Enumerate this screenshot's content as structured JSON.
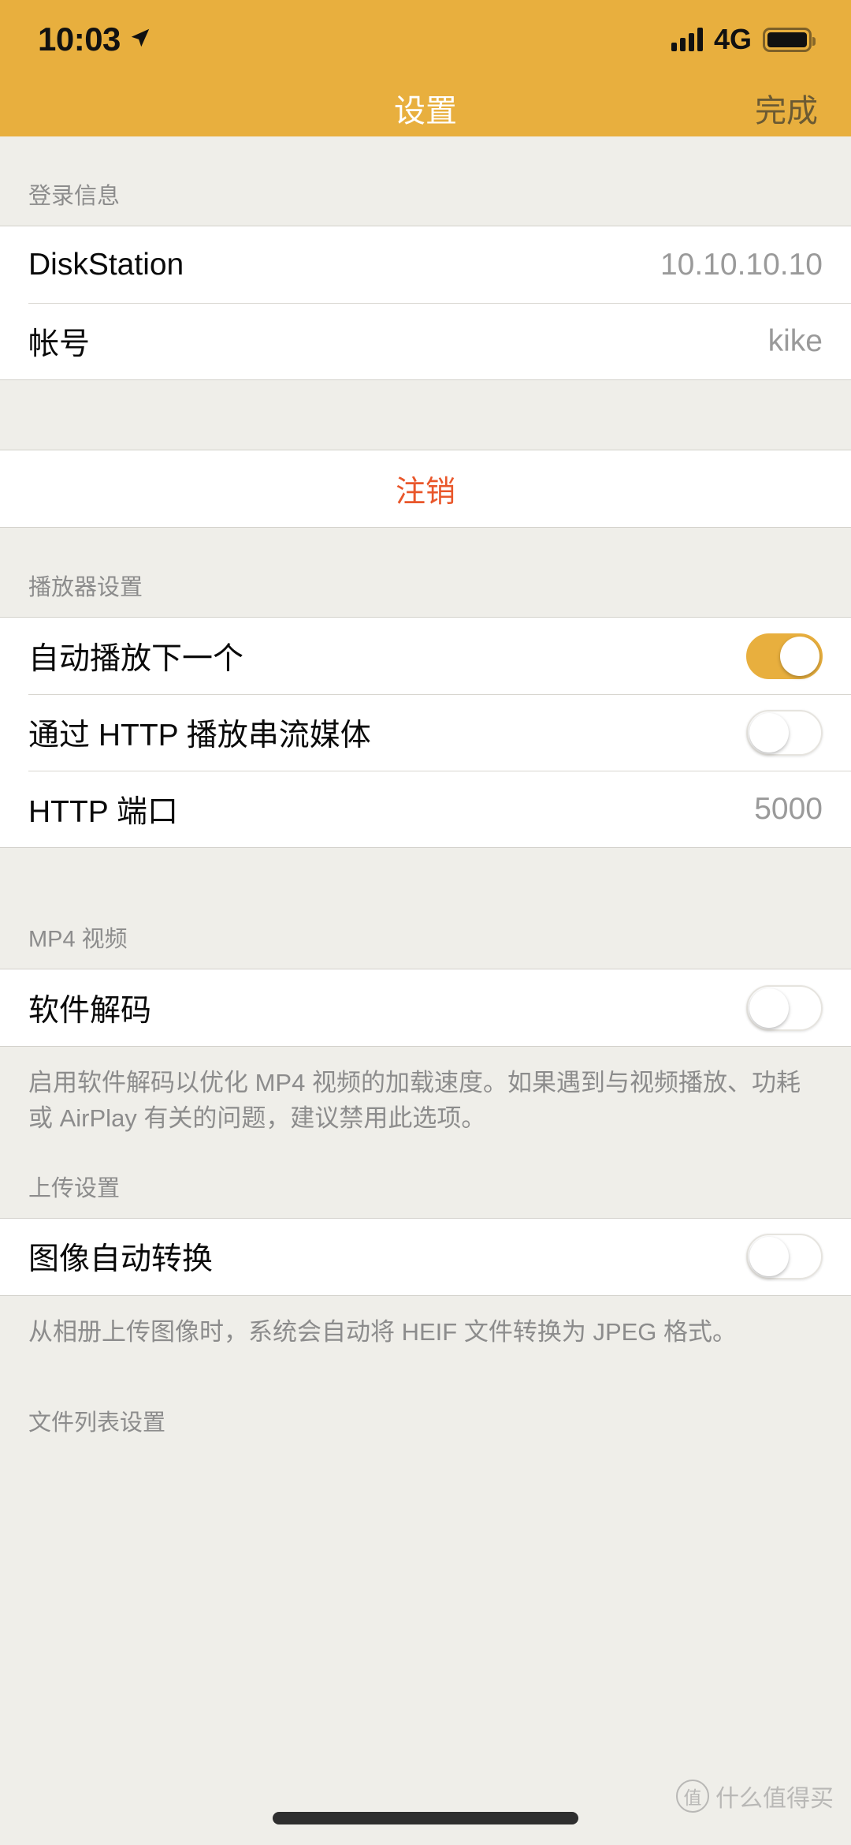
{
  "status_bar": {
    "time": "10:03",
    "location_icon": "location-arrow-icon",
    "network": "4G",
    "signal_icon": "signal-bars-icon",
    "battery_icon": "battery-icon"
  },
  "nav": {
    "title": "设置",
    "done_label": "完成"
  },
  "colors": {
    "accent": "#E8AF3E",
    "destructive": "#E9572B",
    "group_bg": "#EFEEE9",
    "cell_bg": "#FFFFFF",
    "value_text": "#9A9A9A",
    "header_text": "#8C8C8C"
  },
  "sections": {
    "login": {
      "header": "登录信息",
      "rows": [
        {
          "label": "DiskStation",
          "value": "10.10.10.10"
        },
        {
          "label": "帐号",
          "value": "kike"
        }
      ],
      "logout_label": "注销"
    },
    "player": {
      "header": "播放器设置",
      "rows": [
        {
          "label": "自动播放下一个",
          "toggle": "on"
        },
        {
          "label": "通过 HTTP 播放串流媒体",
          "toggle": "off"
        },
        {
          "label": "HTTP 端口",
          "value": "5000"
        }
      ]
    },
    "mp4": {
      "header": "MP4 视频",
      "rows": [
        {
          "label": "软件解码",
          "toggle": "off"
        }
      ],
      "footnote": "启用软件解码以优化 MP4 视频的加载速度。如果遇到与视频播放、功耗或 AirPlay 有关的问题，建议禁用此选项。"
    },
    "upload": {
      "header": "上传设置",
      "rows": [
        {
          "label": "图像自动转换",
          "toggle": "off"
        }
      ],
      "footnote": "从相册上传图像时，系统会自动将 HEIF 文件转换为 JPEG 格式。"
    },
    "file_list": {
      "header": "文件列表设置"
    }
  },
  "watermark": {
    "badge": "值",
    "text": "什么值得买"
  }
}
